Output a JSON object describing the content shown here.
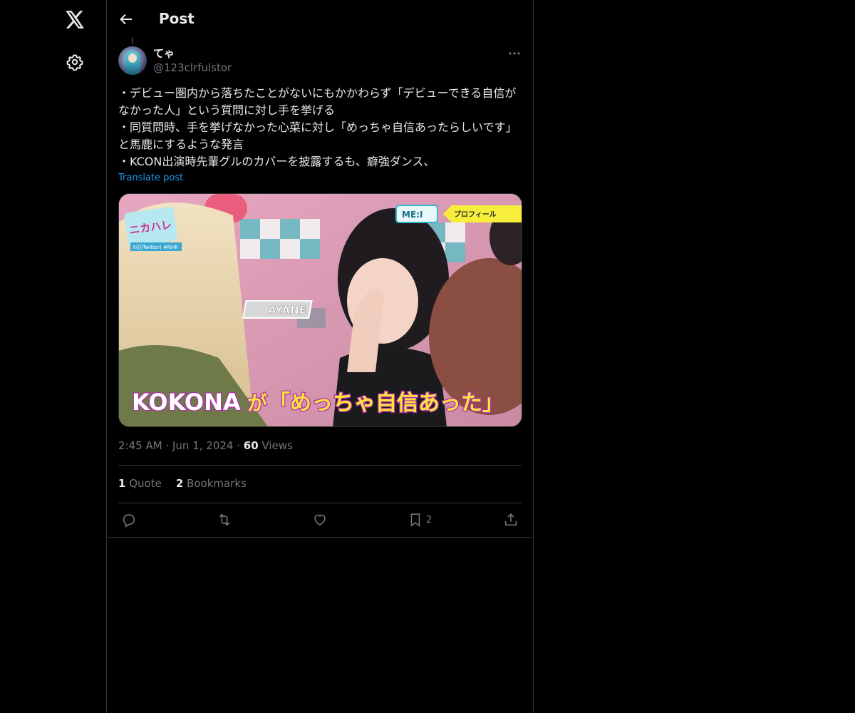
{
  "nav": {
    "logo_icon": "x-logo-icon",
    "settings_icon": "gear-icon"
  },
  "header": {
    "title": "Post",
    "back_icon": "arrow-left-icon"
  },
  "post": {
    "author": {
      "display_name": "てゃ",
      "handle": "@123clrfulstor"
    },
    "text": "・デビュー圏内から落ちたことがないにもかかわらず「デビューできる自信がなかった人」という質問に対し手を挙げる\n・同質問時、手を挙げなかった心菜に対し「めっちゃ自信あったらしいです」と馬鹿にするような発言\n・KCON出演時先輩グルのカバーを披露するも、癖強ダンス、",
    "translate_label": "Translate post",
    "media": {
      "description_icon": "video-thumbnail",
      "caption_left": "KOKONA",
      "caption_mid": "が",
      "caption_quote": "「めっちゃ自信あった」",
      "name_tag": "AYANE",
      "badge": "ME:I",
      "badge_small": "プロフィール",
      "logo_text": "ニカハレ",
      "hashtag": "X(旧Twitter) #NHK"
    },
    "time": "2:45 AM",
    "date": "Jun 1, 2024",
    "views_count": "60",
    "views_label": "Views",
    "quote_count": "1",
    "quote_label": "Quote",
    "bookmark_count": "2",
    "bookmark_label": "Bookmarks",
    "actions": {
      "bookmark_count": "2"
    }
  },
  "colors": {
    "background": "#000000",
    "text": "#e7e9ea",
    "muted": "#71767b",
    "link": "#1d9bf0",
    "border": "#2f3336"
  }
}
